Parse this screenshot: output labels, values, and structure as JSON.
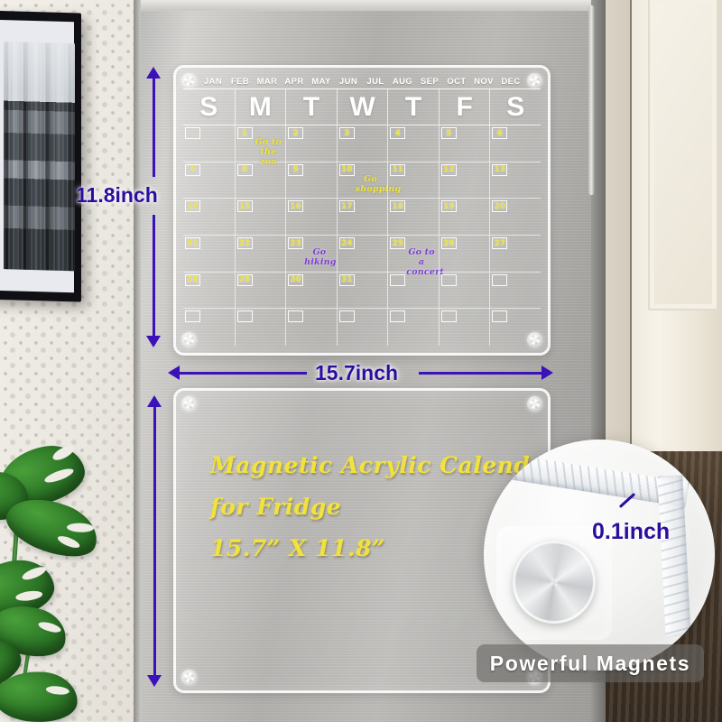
{
  "product": {
    "title_line1": "Magnetic Acrylic Calendar",
    "title_line2": "for Fridge",
    "title_line3": "15.7” X 11.8”"
  },
  "dimensions": {
    "height_label": "11.8inch",
    "width_label": "15.7inch",
    "thickness_label": "0.1inch"
  },
  "banner": {
    "magnets_label": "Powerful Magnets"
  },
  "calendar": {
    "months": [
      "JAN",
      "FEB",
      "MAR",
      "APR",
      "MAY",
      "JUN",
      "JUL",
      "AUG",
      "SEP",
      "OCT",
      "NOV",
      "DEC"
    ],
    "day_headers": [
      "S",
      "M",
      "T",
      "W",
      "T",
      "F",
      "S"
    ],
    "weeks": [
      [
        {
          "day": "",
          "note": "",
          "note_color": ""
        },
        {
          "day": "1",
          "note": "Go to\nthe zoo",
          "note_color": "yellow"
        },
        {
          "day": "2",
          "note": "",
          "note_color": ""
        },
        {
          "day": "3",
          "note": "",
          "note_color": ""
        },
        {
          "day": "4",
          "note": "",
          "note_color": ""
        },
        {
          "day": "5",
          "note": "",
          "note_color": ""
        },
        {
          "day": "6",
          "note": "",
          "note_color": ""
        }
      ],
      [
        {
          "day": "7",
          "note": "",
          "note_color": ""
        },
        {
          "day": "8",
          "note": "",
          "note_color": ""
        },
        {
          "day": "9",
          "note": "",
          "note_color": ""
        },
        {
          "day": "10",
          "note": "Go\nshopping",
          "note_color": "yellow"
        },
        {
          "day": "11",
          "note": "",
          "note_color": ""
        },
        {
          "day": "12",
          "note": "",
          "note_color": ""
        },
        {
          "day": "13",
          "note": "",
          "note_color": ""
        }
      ],
      [
        {
          "day": "14",
          "note": "",
          "note_color": ""
        },
        {
          "day": "15",
          "note": "",
          "note_color": ""
        },
        {
          "day": "16",
          "note": "",
          "note_color": ""
        },
        {
          "day": "17",
          "note": "",
          "note_color": ""
        },
        {
          "day": "18",
          "note": "",
          "note_color": ""
        },
        {
          "day": "19",
          "note": "",
          "note_color": ""
        },
        {
          "day": "20",
          "note": "",
          "note_color": ""
        }
      ],
      [
        {
          "day": "21",
          "note": "",
          "note_color": ""
        },
        {
          "day": "22",
          "note": "",
          "note_color": ""
        },
        {
          "day": "23",
          "note": "Go\nhiking",
          "note_color": "purple"
        },
        {
          "day": "24",
          "note": "",
          "note_color": ""
        },
        {
          "day": "25",
          "note": "Go to\na concert",
          "note_color": "purple"
        },
        {
          "day": "26",
          "note": "",
          "note_color": ""
        },
        {
          "day": "27",
          "note": "",
          "note_color": ""
        }
      ],
      [
        {
          "day": "28",
          "note": "",
          "note_color": ""
        },
        {
          "day": "29",
          "note": "",
          "note_color": ""
        },
        {
          "day": "30",
          "note": "",
          "note_color": ""
        },
        {
          "day": "31",
          "note": "",
          "note_color": ""
        },
        {
          "day": "",
          "note": "",
          "note_color": ""
        },
        {
          "day": "",
          "note": "",
          "note_color": ""
        },
        {
          "day": "",
          "note": "",
          "note_color": ""
        }
      ],
      [
        {
          "day": "",
          "note": "",
          "note_color": ""
        },
        {
          "day": "",
          "note": "",
          "note_color": ""
        },
        {
          "day": "",
          "note": "",
          "note_color": ""
        },
        {
          "day": "",
          "note": "",
          "note_color": ""
        },
        {
          "day": "",
          "note": "",
          "note_color": ""
        },
        {
          "day": "",
          "note": "",
          "note_color": ""
        },
        {
          "day": "",
          "note": "",
          "note_color": ""
        }
      ]
    ]
  },
  "colors": {
    "annotation_blue": "#2c0d9e",
    "arrow_purple": "#3a12b8",
    "marker_yellow": "#f2e23c",
    "marker_purple": "#7b3fd6",
    "board_white": "#ffffff"
  },
  "scene": {
    "wall_art": "city-skyline-photo",
    "plant": "monstera-plant",
    "appliance": "stainless-steel-fridge",
    "cabinets": "kitchen-cabinets"
  }
}
